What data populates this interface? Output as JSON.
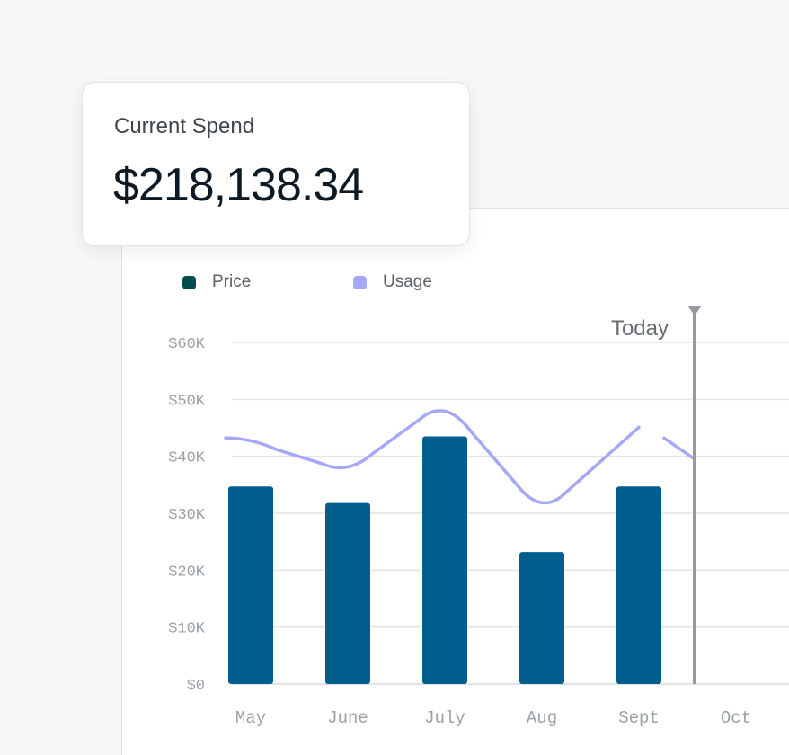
{
  "spend_card": {
    "title": "Current Spend",
    "value": "$218,138.34"
  },
  "legend": {
    "items": [
      {
        "label": "Price",
        "color": "#014d4e"
      },
      {
        "label": "Usage",
        "color": "#a5a8f7"
      }
    ]
  },
  "chart_data": {
    "type": "bar",
    "title": "",
    "xlabel": "",
    "ylabel": "",
    "categories": [
      "May",
      "June",
      "July",
      "Aug",
      "Sept",
      "Oct"
    ],
    "ylim": [
      0,
      60000
    ],
    "y_ticks": [
      0,
      10000,
      20000,
      30000,
      40000,
      50000,
      60000
    ],
    "y_tick_labels": [
      "$0",
      "$10K",
      "$20K",
      "$30K",
      "$40K",
      "$50K",
      "$60K"
    ],
    "grid": true,
    "legend_position": "top-left",
    "series": [
      {
        "name": "Price",
        "type": "bar",
        "color": "#025e8c",
        "values": [
          34700,
          31800,
          43500,
          23200,
          34700,
          null
        ]
      },
      {
        "name": "Usage",
        "type": "line",
        "color": "#a5a8f7",
        "values": [
          42600,
          37300,
          49700,
          29900,
          45100,
          null
        ]
      }
    ],
    "today_marker": {
      "label": "Today",
      "position": "between Sept and Oct",
      "color": "#969a9e"
    }
  }
}
